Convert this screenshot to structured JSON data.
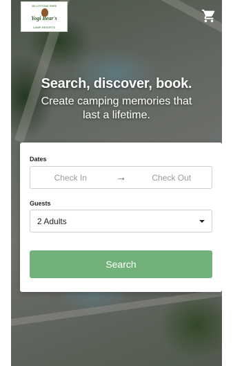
{
  "logo": {
    "arc_text": "JELLYSTONE PARK",
    "name": "Yogi Bear's",
    "sub_text": "CAMP-RESORTS"
  },
  "header": {
    "cart_icon": "shopping-cart-icon"
  },
  "hero": {
    "title": "Search, discover, book.",
    "subtitle": "Create camping memories that last a lifetime."
  },
  "booking": {
    "dates_label": "Dates",
    "check_in_placeholder": "Check In",
    "arrow_icon": "arrow-right-icon",
    "check_out_placeholder": "Check Out",
    "guests_label": "Guests",
    "guests_value": "2 Adults",
    "dropdown_icon": "caret-down-icon",
    "search_label": "Search"
  },
  "colors": {
    "search_button": "#72b17a",
    "logo_green": "#2d5a2a",
    "text_dark": "#222222",
    "placeholder": "#9a9a9a"
  }
}
